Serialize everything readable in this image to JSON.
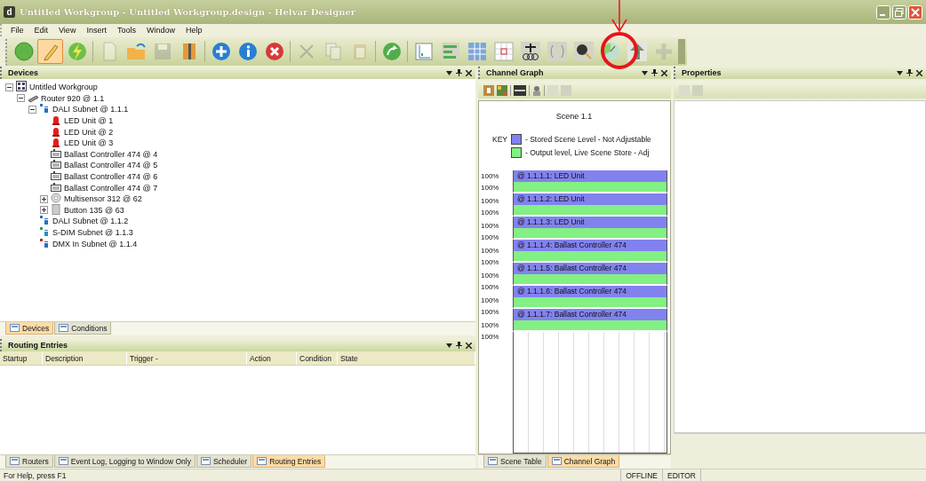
{
  "window": {
    "icon_text": "d",
    "title": "Untitled Workgroup - Untitled Workgroup.design - Helvar Designer"
  },
  "menu": [
    "File",
    "Edit",
    "View",
    "Insert",
    "Tools",
    "Window",
    "Help"
  ],
  "toolbar": [
    [
      {
        "selected": false,
        "disabled": false
      },
      {
        "selected": true,
        "disabled": false
      },
      {
        "selected": false,
        "disabled": false
      }
    ],
    [
      {
        "selected": false,
        "disabled": true
      },
      {
        "selected": false,
        "disabled": false
      },
      {
        "selected": false,
        "disabled": true
      },
      {
        "selected": false,
        "disabled": false
      }
    ],
    [
      {
        "selected": false,
        "disabled": false
      },
      {
        "selected": false,
        "disabled": false
      },
      {
        "selected": false,
        "disabled": false
      }
    ],
    [
      {
        "selected": false,
        "disabled": true
      },
      {
        "selected": false,
        "disabled": true
      },
      {
        "selected": false,
        "disabled": true
      }
    ],
    [
      {
        "selected": false,
        "disabled": false
      }
    ],
    [
      {
        "selected": false,
        "disabled": false
      },
      {
        "selected": false,
        "disabled": false
      },
      {
        "selected": false,
        "disabled": false
      },
      {
        "selected": false,
        "disabled": false
      },
      {
        "selected": false,
        "disabled": false
      },
      {
        "selected": false,
        "disabled": false
      },
      {
        "selected": false,
        "disabled": false
      },
      {
        "selected": false,
        "disabled": false
      },
      {
        "selected": false,
        "disabled": false
      },
      {
        "selected": false,
        "disabled": true
      }
    ]
  ],
  "devices": {
    "title": "Devices",
    "tree": [
      {
        "label": "Untitled Workgroup",
        "kind": "workgroup",
        "expanded": true,
        "children": [
          {
            "label": "Router 920 @ 1.1",
            "kind": "router",
            "expanded": true,
            "children": [
              {
                "label": "DALI Subnet @ 1.1.1",
                "kind": "dali-subnet",
                "expanded": true,
                "children": [
                  {
                    "label": "LED Unit @ 1",
                    "kind": "led"
                  },
                  {
                    "label": "LED Unit @ 2",
                    "kind": "led"
                  },
                  {
                    "label": "LED Unit @ 3",
                    "kind": "led"
                  },
                  {
                    "label": "Ballast Controller 474 @ 4",
                    "kind": "ballast"
                  },
                  {
                    "label": "Ballast Controller 474 @ 5",
                    "kind": "ballast"
                  },
                  {
                    "label": "Ballast Controller 474 @ 6",
                    "kind": "ballast"
                  },
                  {
                    "label": "Ballast Controller 474 @ 7",
                    "kind": "ballast"
                  },
                  {
                    "label": "Multisensor 312 @ 62",
                    "kind": "sensor",
                    "expanded": false
                  },
                  {
                    "label": "Button 135 @ 63",
                    "kind": "button",
                    "expanded": false
                  }
                ]
              },
              {
                "label": "DALI Subnet @ 1.1.2",
                "kind": "dali-subnet"
              },
              {
                "label": "S-DIM Subnet @ 1.1.3",
                "kind": "sdim-subnet"
              },
              {
                "label": "DMX In Subnet @ 1.1.4",
                "kind": "dmx-subnet"
              }
            ]
          }
        ]
      }
    ],
    "tabs": [
      {
        "label": "Devices",
        "selected": true
      },
      {
        "label": "Conditions",
        "selected": false
      }
    ]
  },
  "routing": {
    "title": "Routing Entries",
    "columns": [
      "Startup",
      "Description",
      "Trigger -",
      "Action",
      "Condition",
      "State"
    ]
  },
  "bottom_tabs": [
    {
      "label": "Routers",
      "selected": false
    },
    {
      "label": "Event Log, Logging to Window Only",
      "selected": false
    },
    {
      "label": "Scheduler",
      "selected": false
    },
    {
      "label": "Routing Entries",
      "selected": true
    }
  ],
  "channel_graph": {
    "title": "Channel Graph",
    "scene_title": "Scene 1.1",
    "key_label": "KEY",
    "key": [
      {
        "label": "- Stored Scene Level - Not Adjustable",
        "color": "#8282ee"
      },
      {
        "label": "- Output level, Live Scene Store - Adj",
        "color": "#82f082"
      }
    ],
    "channels": [
      {
        "name": "@ 1.1.1.1: LED Unit",
        "stored": {
          "reading": "100%",
          "level": 1
        },
        "output": {
          "reading": "100%",
          "level": 1
        }
      },
      {
        "name": "@ 1.1.1.2: LED Unit",
        "stored": {
          "reading": "100%",
          "level": 1
        },
        "output": {
          "reading": "100%",
          "level": 1
        }
      },
      {
        "name": "@ 1.1.1.3: LED Unit",
        "stored": {
          "reading": "100%",
          "level": 1
        },
        "output": {
          "reading": "100%",
          "level": 1
        }
      },
      {
        "name": "@ 1.1.1.4: Ballast Controller 474",
        "stored": {
          "reading": "100%",
          "level": 1
        },
        "output": {
          "reading": "100%",
          "level": 1
        }
      },
      {
        "name": "@ 1.1.1.5: Ballast Controller 474",
        "stored": {
          "reading": "100%",
          "level": 1
        },
        "output": {
          "reading": "100%",
          "level": 1
        }
      },
      {
        "name": "@ 1.1.1.6: Ballast Controller 474",
        "stored": {
          "reading": "100%",
          "level": 1
        },
        "output": {
          "reading": "100%",
          "level": 1
        }
      },
      {
        "name": "@ 1.1.1.7: Ballast Controller 474",
        "stored": {
          "reading": "100%",
          "level": 1
        },
        "output": {
          "reading": "100%",
          "level": 1
        }
      }
    ],
    "tabs": [
      {
        "label": "Scene Table",
        "selected": false
      },
      {
        "label": "Channel Graph",
        "selected": true
      }
    ]
  },
  "properties": {
    "title": "Properties"
  },
  "status_bar": {
    "help": "For Help, press F1",
    "panels": [
      "OFFLINE",
      "EDITOR"
    ]
  },
  "annotations": [
    {
      "kind": "arrow"
    },
    {
      "kind": "circle"
    }
  ]
}
